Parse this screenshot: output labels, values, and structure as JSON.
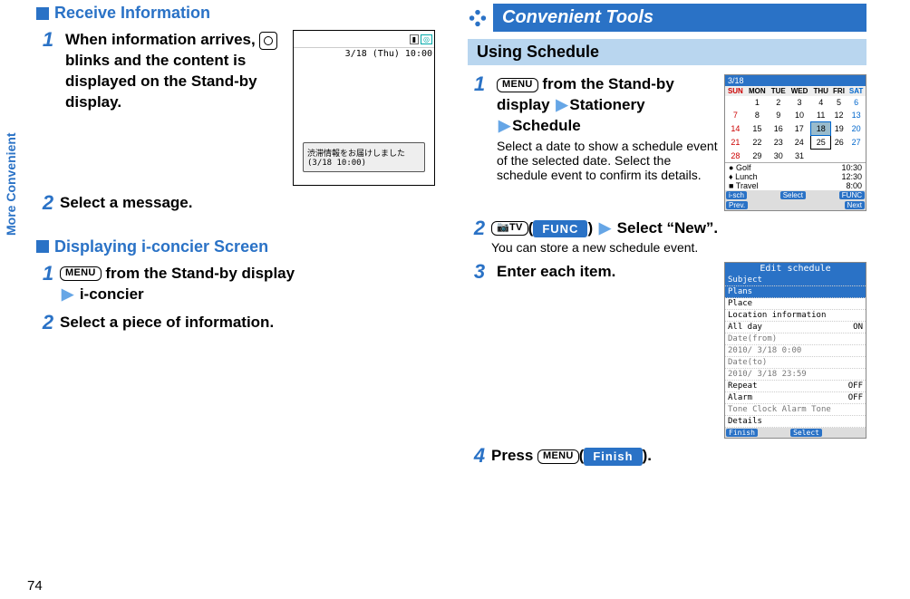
{
  "side_label": "More Convenient",
  "page_number": "74",
  "left": {
    "sections": {
      "receive": {
        "title": "Receive Information"
      },
      "iconcier": {
        "title": "Displaying i-concier Screen"
      }
    },
    "steps": {
      "r1": "When information arrives,        blinks and the content is displayed on the Stand-by display.",
      "r1_prefix": "When information arrives, ",
      "r1_suffix": " blinks and the content is displayed on the Stand-by display.",
      "r2": "Select a message.",
      "i1_prefix": " from the Stand-by display",
      "i1_menu_label": "MENU",
      "i1_second": "i-concier",
      "i2": "Select a piece of information."
    },
    "illustration": {
      "clock": "3/18 (Thu) 10:00",
      "popup_line1": "渋滞情報をお届けしました",
      "popup_line2": "(3/18 10:00)"
    }
  },
  "right": {
    "banner": "Convenient Tools",
    "subbanner": "Using Schedule",
    "steps": {
      "s1_menu": "MENU",
      "s1_a": " from the Stand-by display",
      "s1_b": "Stationery",
      "s1_c": "Schedule",
      "s1_desc": "Select a date to show a schedule event of the selected date. Select the schedule event to confirm its details.",
      "s2_key": "📷TV",
      "s2_paren_open": "(",
      "s2_btn": "FUNC",
      "s2_paren_close": ")",
      "s2_tail": "Select “New”.",
      "s2_desc": "You can store a new schedule event.",
      "s3": "Enter each item.",
      "s4_pre": "Press ",
      "s4_menu": "MENU",
      "s4_paren_open": "(",
      "s4_btn": "Finish",
      "s4_paren_close": ").",
      "s4_dot": ""
    },
    "calendar": {
      "title": "3/18",
      "days": [
        "SUN",
        "MON",
        "TUE",
        "WED",
        "THU",
        "FRI",
        "SAT"
      ],
      "rows": [
        [
          "",
          "1",
          "2",
          "3",
          "4",
          "5",
          "6"
        ],
        [
          "7",
          "8",
          "9",
          "10",
          "11",
          "12",
          "13"
        ],
        [
          "14",
          "15",
          "16",
          "17",
          "18",
          "19",
          "20"
        ],
        [
          "21",
          "22",
          "23",
          "24",
          "25",
          "26",
          "27"
        ],
        [
          "28",
          "29",
          "30",
          "31",
          "",
          "",
          ""
        ]
      ],
      "events": [
        {
          "name": "Golf",
          "time": "10:30"
        },
        {
          "name": "Lunch",
          "time": "12:30"
        },
        {
          "name": "Travel",
          "time": "8:00"
        }
      ],
      "softkeys": {
        "left": "i-sch",
        "prev": "Prev.",
        "center": "Select",
        "next": "Next",
        "right": "FUNC"
      }
    },
    "edit_schedule": {
      "title": "Edit schedule",
      "fields": {
        "subject_label": "Subject",
        "subject_value": "Plans",
        "place_label": "Place",
        "location_label": "Location information",
        "allday_label": "All day",
        "allday_value": "ON",
        "datefrom_label": "Date(from)",
        "datefrom_value": "2010/ 3/18  0:00",
        "dateto_label": "Date(to)",
        "dateto_value": "2010/ 3/18 23:59",
        "repeat_label": "Repeat",
        "repeat_value": "OFF",
        "alarm_label": "Alarm",
        "alarm_value": "OFF",
        "tone_label": "Tone  Clock Alarm Tone",
        "details_label": "Details"
      },
      "softkeys": {
        "left": "Finish",
        "center": "Select"
      }
    }
  }
}
